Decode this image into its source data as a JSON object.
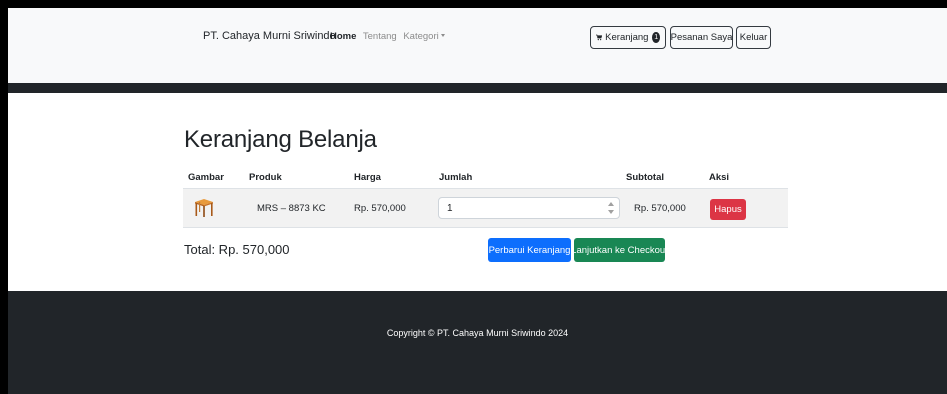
{
  "navbar": {
    "brand": "PT. Cahaya Murni Sriwindo",
    "links": [
      {
        "label": "Home",
        "active": true
      },
      {
        "label": "Tentang",
        "active": false
      },
      {
        "label": "Kategori",
        "active": false,
        "dropdown": true
      }
    ],
    "cart_label": "Keranjang",
    "cart_count": "1",
    "orders_label": "Pesanan Saya",
    "logout_label": "Keluar"
  },
  "cart": {
    "title": "Keranjang Belanja",
    "columns": [
      "Gambar",
      "Produk",
      "Harga",
      "Jumlah",
      "Subtotal",
      "Aksi"
    ],
    "items": [
      {
        "image_icon": "table-icon",
        "product": "MRS – 8873 KC",
        "price": "Rp. 570,000",
        "quantity": "1",
        "subtotal": "Rp. 570,000",
        "action": "Hapus"
      }
    ],
    "total": "Total: Rp. 570,000",
    "update_label": "Perbarui Keranjang",
    "checkout_label": "Lanjutkan ke Checkout"
  },
  "footer": {
    "copyright": "Copyright © PT. Cahaya Murni Sriwindo 2024"
  },
  "colors": {
    "danger": "#dc3545",
    "primary": "#0d6efd",
    "success": "#198754",
    "dark": "#212529",
    "light": "#f8f9fa"
  }
}
